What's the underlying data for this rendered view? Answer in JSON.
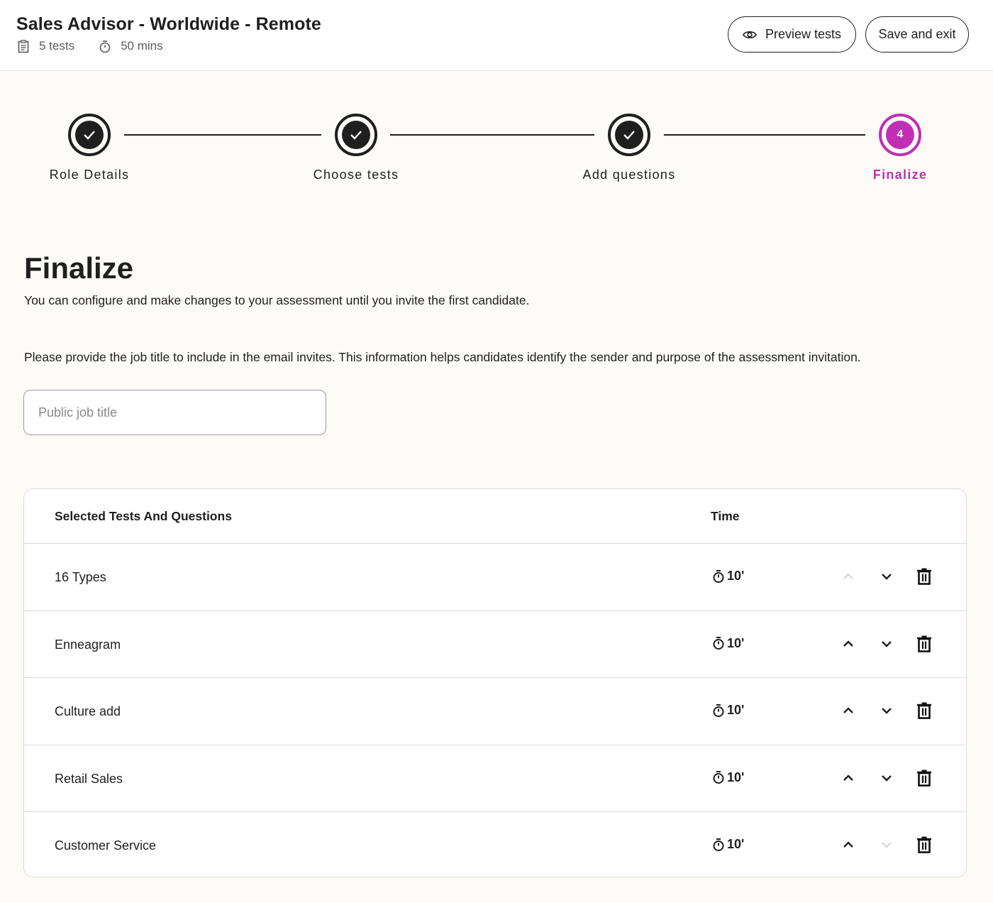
{
  "header": {
    "title": "Sales Advisor - Worldwide - Remote",
    "tests_count": "5 tests",
    "duration": "50 mins",
    "preview_label": "Preview tests",
    "save_label": "Save and exit"
  },
  "stepper": {
    "steps": [
      {
        "label": "Role Details",
        "status": "completed"
      },
      {
        "label": "Choose tests",
        "status": "completed"
      },
      {
        "label": "Add questions",
        "status": "completed"
      },
      {
        "label": "Finalize",
        "status": "active",
        "number": "4"
      }
    ],
    "accent_color": "#c02fb4"
  },
  "main": {
    "title": "Finalize",
    "subtitle": "You can configure and make changes to your assessment until you invite the first candidate.",
    "instruction": "Please provide the job title to include in the email invites. This information helps candidates identify the sender and purpose of the assessment invitation.",
    "job_title_input": {
      "value": "",
      "placeholder": "Public job title"
    }
  },
  "table": {
    "headers": {
      "name": "Selected Tests And Questions",
      "time": "Time"
    },
    "rows": [
      {
        "name": "16 Types",
        "time": "10'",
        "can_move_up": false,
        "can_move_down": true
      },
      {
        "name": "Enneagram",
        "time": "10'",
        "can_move_up": true,
        "can_move_down": true
      },
      {
        "name": "Culture add",
        "time": "10'",
        "can_move_up": true,
        "can_move_down": true
      },
      {
        "name": "Retail Sales",
        "time": "10'",
        "can_move_up": true,
        "can_move_down": true
      },
      {
        "name": "Customer Service",
        "time": "10'",
        "can_move_up": true,
        "can_move_down": false
      }
    ]
  }
}
